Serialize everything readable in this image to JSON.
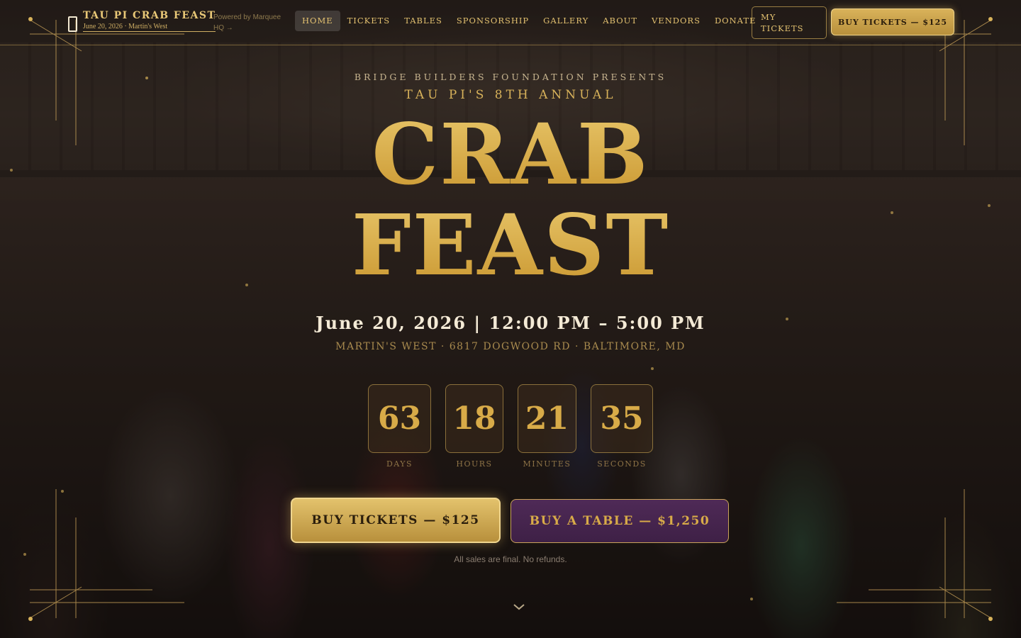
{
  "brand": {
    "title": "TAU PI CRAB FEAST",
    "subtitle": "June 20, 2026 · Martin's West",
    "icon": "phone-icon",
    "powered_by": "Powered by Marquee HQ →"
  },
  "nav": {
    "items": [
      {
        "label": "HOME",
        "active": true
      },
      {
        "label": "TICKETS",
        "active": false
      },
      {
        "label": "TABLES",
        "active": false
      },
      {
        "label": "SPONSORSHIP",
        "active": false
      },
      {
        "label": "GALLERY",
        "active": false
      },
      {
        "label": "ABOUT",
        "active": false
      },
      {
        "label": "VENDORS",
        "active": false
      },
      {
        "label": "DONATE",
        "active": false
      }
    ],
    "my_tickets_label": "MY TICKETS",
    "buy_label": "BUY TICKETS — $125"
  },
  "hero": {
    "presenter": "BRIDGE BUILDERS FOUNDATION PRESENTS",
    "edition": "TAU PI'S 8TH ANNUAL",
    "headline_line1": "CRAB",
    "headline_line2": "FEAST",
    "date_time": "June 20, 2026 | 12:00 PM – 5:00 PM",
    "venue": "MARTIN'S WEST · 6817 DOGWOOD RD · BALTIMORE, MD",
    "countdown": [
      {
        "value": "63",
        "unit": "DAYS"
      },
      {
        "value": "18",
        "unit": "HOURS"
      },
      {
        "value": "21",
        "unit": "MINUTES"
      },
      {
        "value": "35",
        "unit": "SECONDS"
      }
    ],
    "buy_tickets_label": "BUY TICKETS — $125",
    "buy_table_label": "BUY A TABLE — $1,250",
    "note": "All sales are final. No refunds.",
    "scroll_icon": "chevron-down-icon"
  },
  "colors": {
    "gold": "#d8b25a",
    "gold_dark": "#b8903c",
    "purple": "#4f2a57",
    "cream": "#f4ead6"
  }
}
